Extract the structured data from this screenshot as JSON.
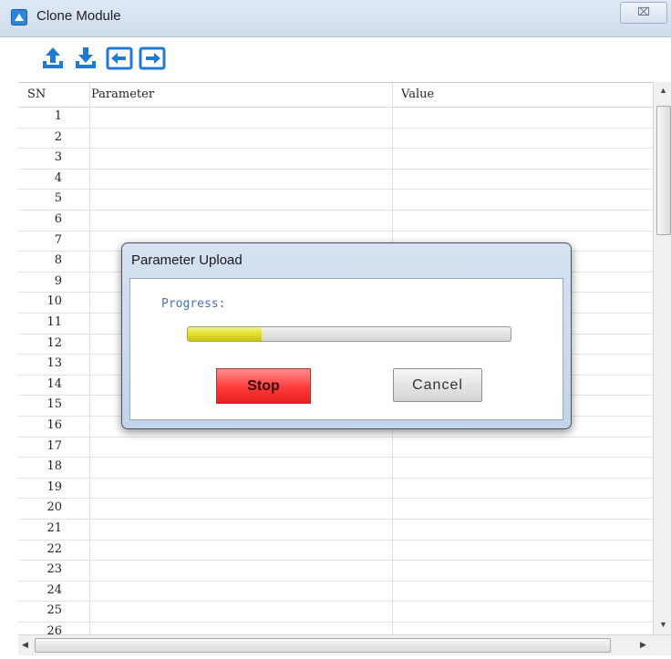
{
  "window": {
    "title": "Clone Module",
    "close_label": "⌧"
  },
  "toolbar": {
    "buttons": [
      {
        "icon": "upload-icon"
      },
      {
        "icon": "download-icon"
      },
      {
        "icon": "import-icon"
      },
      {
        "icon": "export-icon"
      }
    ]
  },
  "grid": {
    "columns": [
      "SN",
      "Parameter",
      "Value"
    ],
    "rows": [
      "1",
      "2",
      "3",
      "4",
      "5",
      "6",
      "7",
      "8",
      "9",
      "10",
      "11",
      "12",
      "13",
      "14",
      "15",
      "16",
      "17",
      "18",
      "19",
      "20",
      "21",
      "22",
      "23",
      "24",
      "25",
      "26"
    ]
  },
  "dialog": {
    "title": "Parameter Upload",
    "progress_label": "Progress:",
    "progress_value": 0.23,
    "stop_label": "Stop",
    "cancel_label": "Cancel"
  },
  "colors": {
    "accent": "#1f7ad6",
    "stop": "#ff3a3a",
    "progress": "#e0dc1c"
  }
}
